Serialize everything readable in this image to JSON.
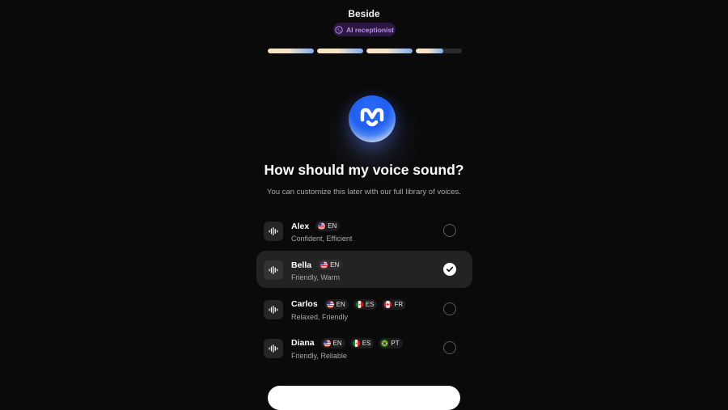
{
  "app": {
    "title": "Beside"
  },
  "badge": {
    "label": "AI receptionist"
  },
  "progress": {
    "steps": [
      1,
      1,
      1,
      0.6
    ]
  },
  "heading": "How should my voice sound?",
  "subheading": "You can customize this later with our full library of voices.",
  "voices": [
    {
      "name": "Alex",
      "langs": [
        {
          "code": "EN",
          "flag": "us-flag-icon"
        }
      ],
      "tags": "Confident, Efficient",
      "selected": false
    },
    {
      "name": "Bella",
      "langs": [
        {
          "code": "EN",
          "flag": "us-flag-icon"
        }
      ],
      "tags": "Friendly, Warm",
      "selected": true
    },
    {
      "name": "Carlos",
      "langs": [
        {
          "code": "EN",
          "flag": "us-flag-icon"
        },
        {
          "code": "ES",
          "flag": "mx-flag-icon"
        },
        {
          "code": "FR",
          "flag": "ca-flag-icon"
        }
      ],
      "tags": "Relaxed, Friendly",
      "selected": false
    },
    {
      "name": "Diana",
      "langs": [
        {
          "code": "EN",
          "flag": "us-flag-icon"
        },
        {
          "code": "ES",
          "flag": "mx-flag-icon"
        },
        {
          "code": "PT",
          "flag": "br-flag-icon"
        }
      ],
      "tags": "Friendly, Reliable",
      "selected": false
    }
  ],
  "colors": {
    "accent": "#b98cf5",
    "badge_bg": "#2a1840",
    "selected_row": "#232323",
    "orb_blue": "#1e5ff0"
  }
}
